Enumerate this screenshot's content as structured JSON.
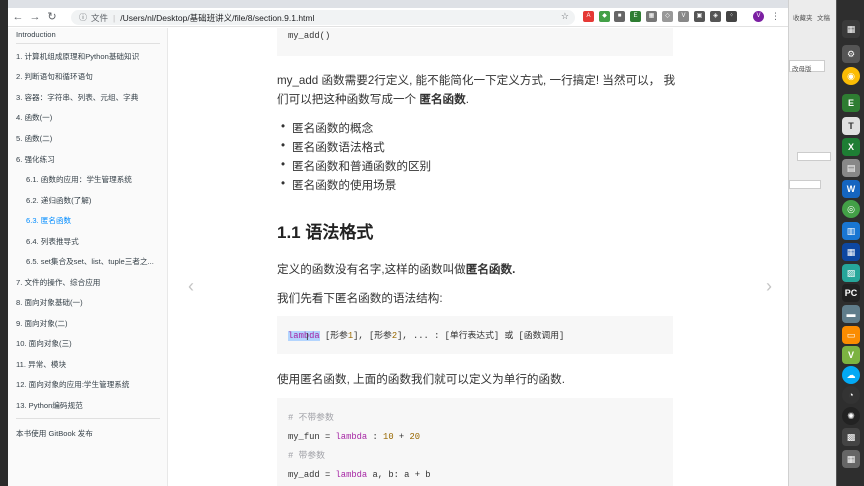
{
  "browser": {
    "address": {
      "info_label": "文件",
      "url": "/Users/nl/Desktop/基础班讲义/file/8/section.9.1.html"
    }
  },
  "sidebar": {
    "items": [
      {
        "label": "Introduction"
      },
      {
        "label": "1. 计算机组成原理和Python基础知识"
      },
      {
        "label": "2. 判断语句和循环语句"
      },
      {
        "label": "3. 容器：字符串、列表、元组、字典"
      },
      {
        "label": "4. 函数(一)"
      },
      {
        "label": "5. 函数(二)"
      },
      {
        "label": "6. 强化练习"
      },
      {
        "label": "6.1. 函数的应用：学生管理系统"
      },
      {
        "label": "6.2. 递归函数(了解)"
      },
      {
        "label": "6.3. 匿名函数"
      },
      {
        "label": "6.4. 列表推导式"
      },
      {
        "label": "6.5. set集合及set、list、tuple三者之..."
      },
      {
        "label": "7. 文件的操作、综合应用"
      },
      {
        "label": "8. 面向对象基础(一)"
      },
      {
        "label": "9. 面向对象(二)"
      },
      {
        "label": "10. 面向对象(三)"
      },
      {
        "label": "11. 异常、模块"
      },
      {
        "label": "12. 面向对象的应用:学生管理系统"
      },
      {
        "label": "13. Python编码规范"
      }
    ],
    "footer": "本书使用 GitBook 发布"
  },
  "content": {
    "code_top": "my_add()",
    "para1_line1": "my_add 函数需要2行定义, 能不能简化一下定义方式, 一行搞定! 当然可以， 我",
    "para1_line2_prefix": "们可以把这种函数写成一个 ",
    "para1_line2_bold": "匿名函数",
    "para1_line2_suffix": ".",
    "bullets": [
      "匿名函数的概念",
      "匿名函数语法格式",
      "匿名函数和普通函数的区别",
      "匿名函数的使用场景"
    ],
    "heading": "1.1 语法格式",
    "para2_prefix": "定义的函数没有名字,这样的函数叫做",
    "para2_bold": "匿名函数.",
    "para3": "我们先看下匿名函数的语法结构:",
    "syntax": {
      "kw_a": "la",
      "kw_b": "mbda",
      "p1": " [形参",
      "n1": "1",
      "p2": "], [形参",
      "n2": "2",
      "p3": "], ... : [单行表达式] 或 [函数调用]"
    },
    "para4": "使用匿名函数, 上面的函数我们就可以定义为单行的函数.",
    "code2": {
      "c1": "# 不带参数",
      "l2_a": "my_fun = ",
      "l2_kw": "lambda",
      "l2_b": " : ",
      "l2_n1": "10",
      "l2_c": " + ",
      "l2_n2": "20",
      "c3": "# 带参数",
      "l4_a": "my_add = ",
      "l4_kw": "lambda",
      "l4_b": " a, b: a + b"
    }
  },
  "right_panel": {
    "label1": "收藏夹",
    "label2": "文稿",
    "label3": "改母版"
  }
}
